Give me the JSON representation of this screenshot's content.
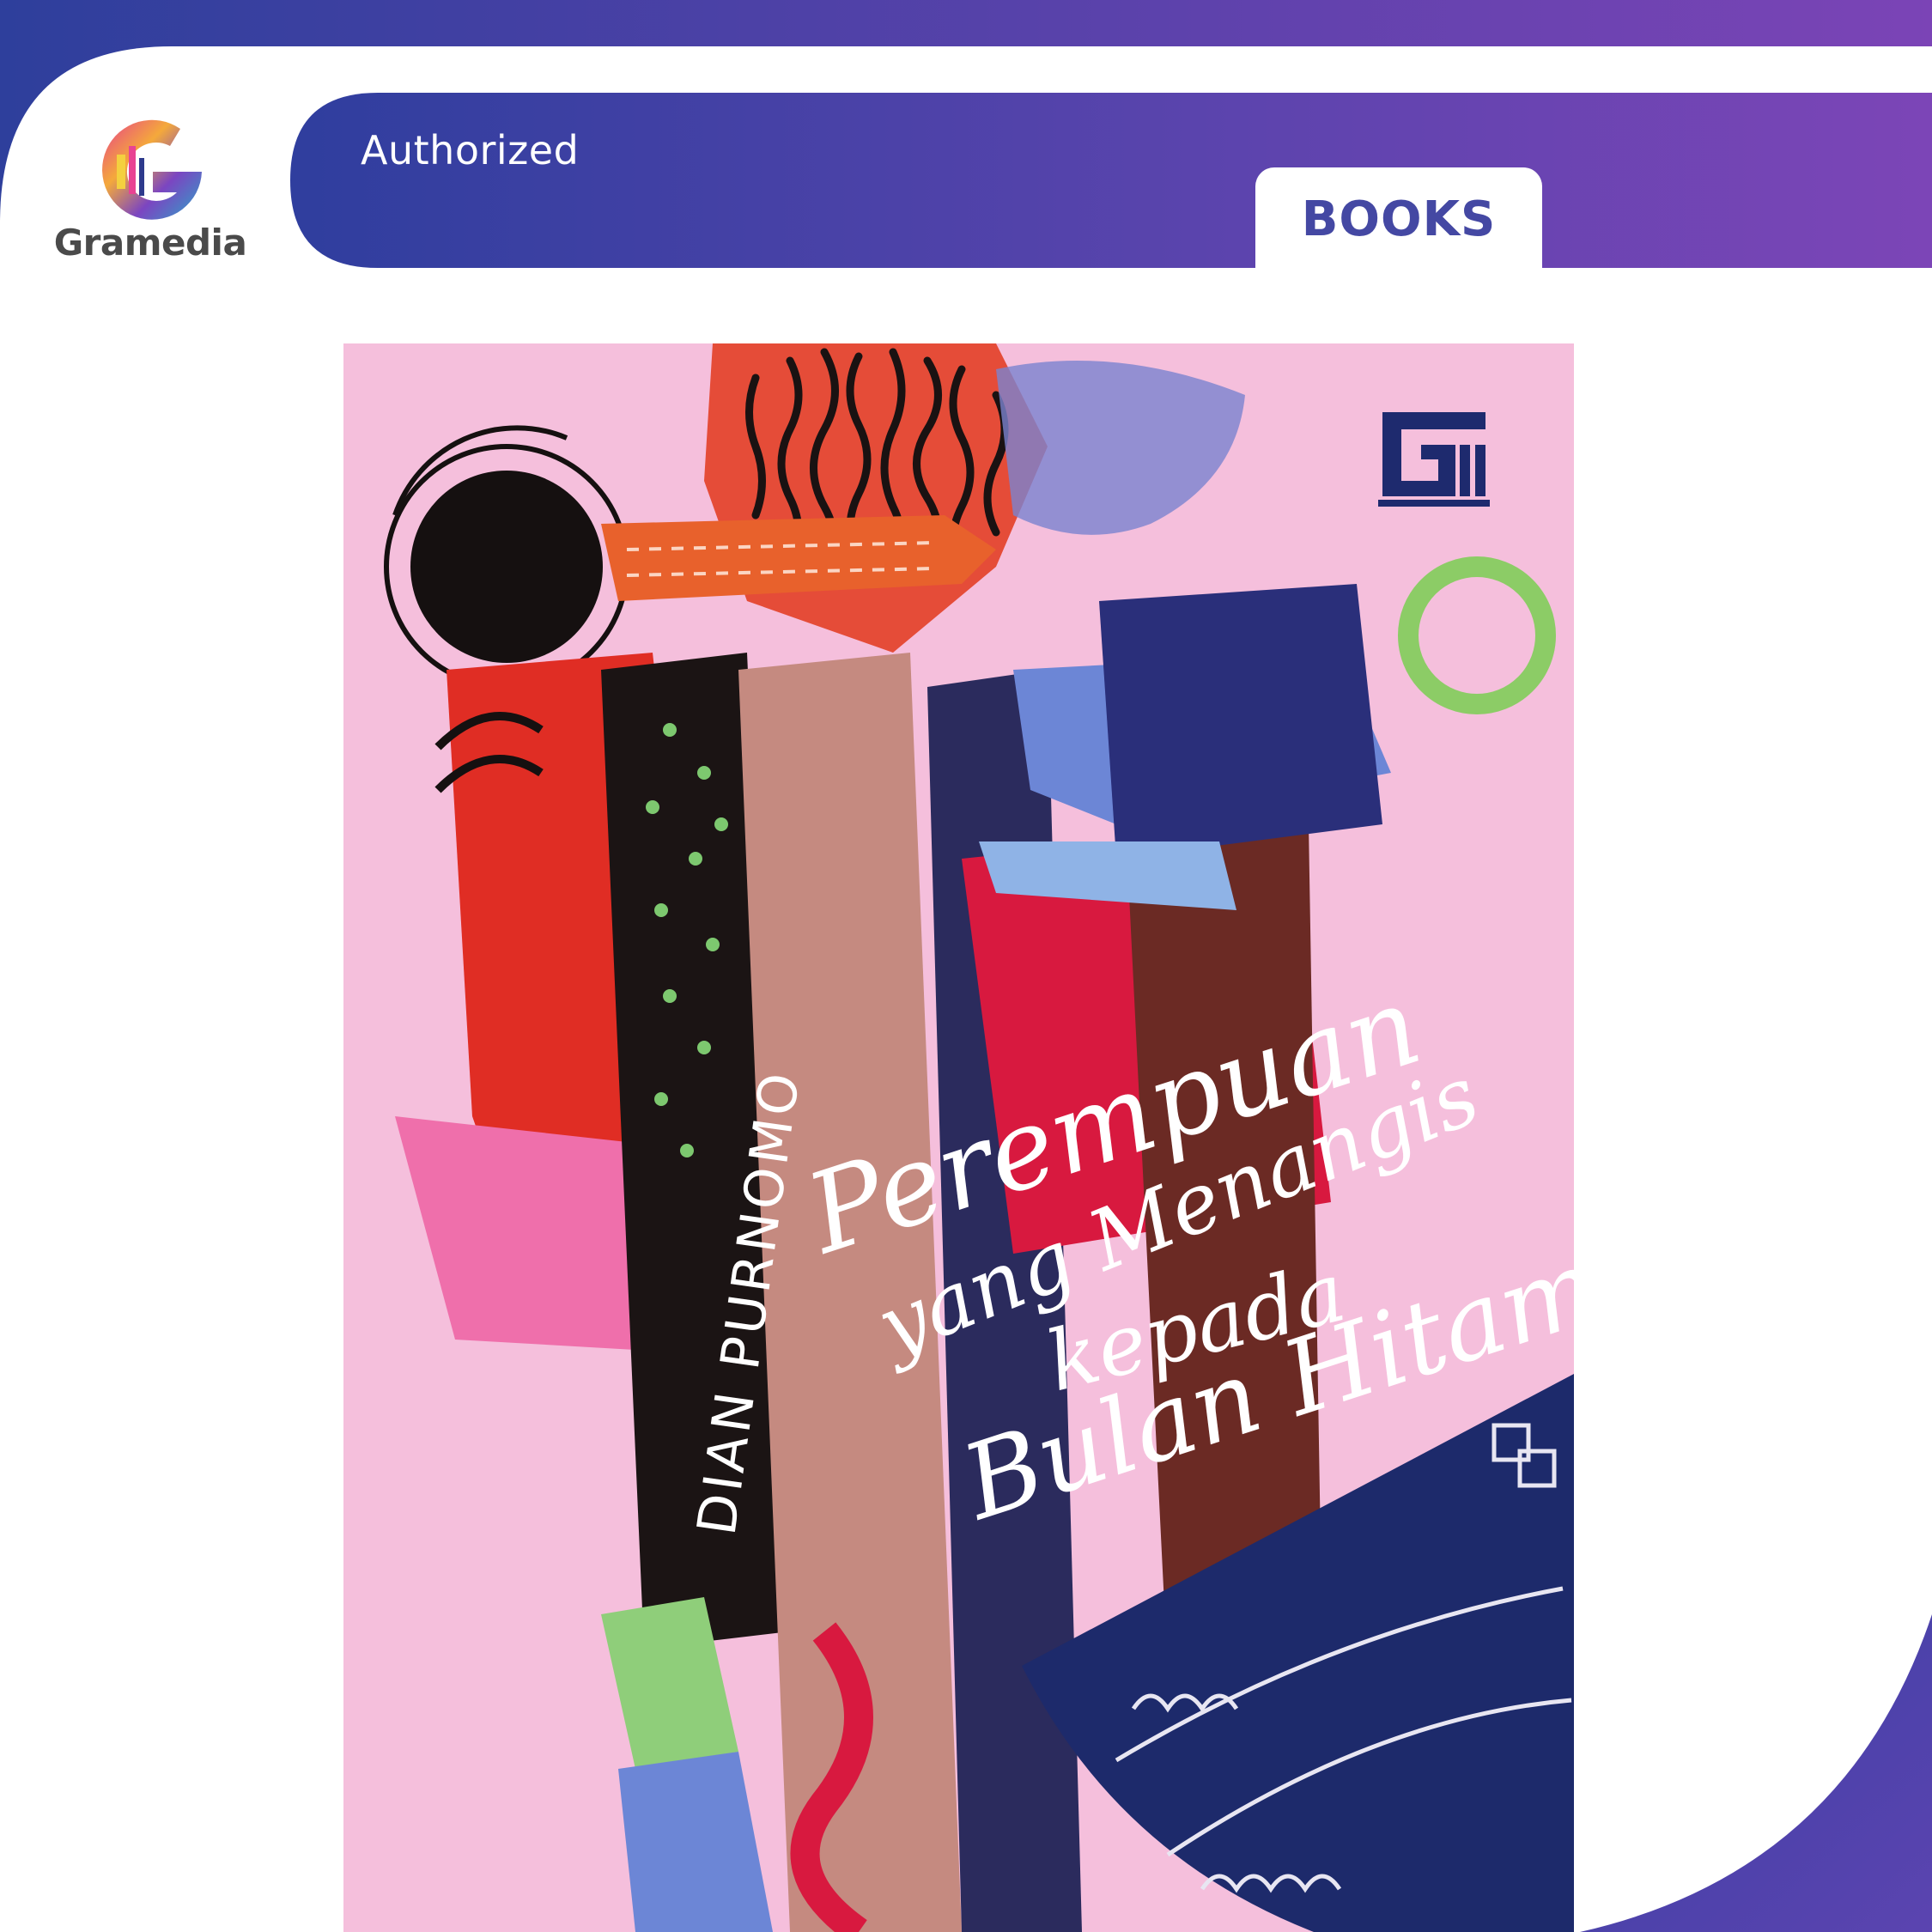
{
  "brand": {
    "name": "Gramedia",
    "badge_text": "Authorized",
    "category_label": "BOOKS",
    "colors": {
      "gradient_start": "#2e3f9c",
      "gradient_end": "#7b44b6",
      "tab_text": "#4448a3",
      "logo_text": "#4a4a4a"
    }
  },
  "book_cover": {
    "publisher_mark": "GM",
    "title_lines": [
      "Perempuan",
      "yang Menangis",
      "kepada",
      "Bulan Hitam"
    ],
    "author": "DIAN PURNOMO",
    "background_color": "#f5bfdc"
  }
}
